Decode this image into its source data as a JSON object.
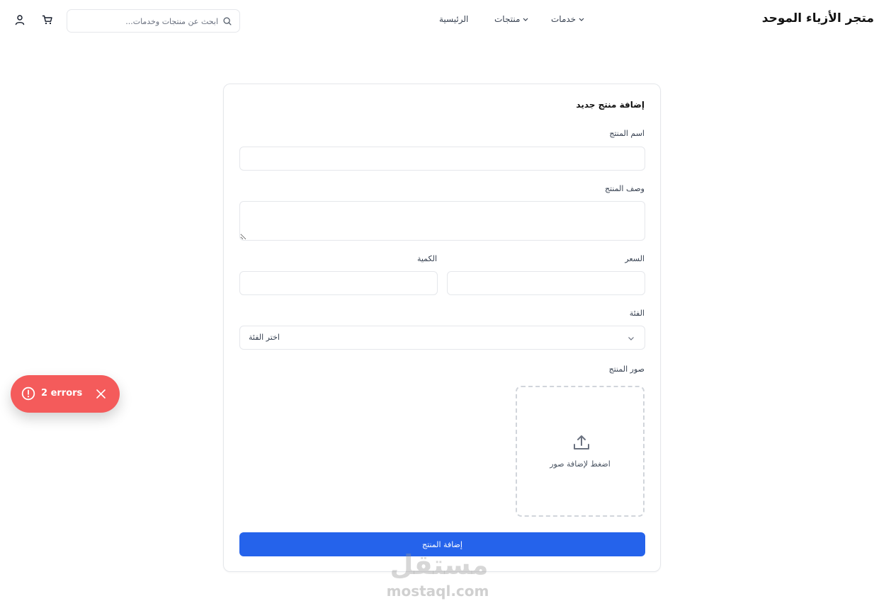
{
  "header": {
    "brand": "متجر الأزياء الموحد",
    "nav": [
      {
        "label": "الرئيسية",
        "has_dropdown": false
      },
      {
        "label": "منتجات",
        "has_dropdown": true
      },
      {
        "label": "خدمات",
        "has_dropdown": true
      }
    ],
    "search": {
      "placeholder": "ابحث عن منتجات وخدمات...",
      "value": "",
      "icon": "search-icon"
    },
    "icons": [
      "cart-icon",
      "user-icon"
    ]
  },
  "form": {
    "title": "إضافة منتج جديد",
    "name_label": "اسم المنتج",
    "name_value": "",
    "description_label": "وصف المنتج",
    "description_value": "",
    "price_label": "السعر",
    "price_value": "",
    "quantity_label": "الكمية",
    "quantity_value": "",
    "category_label": "الفئة",
    "category_value": "اختر الفئة",
    "images_label": "صور المنتج",
    "upload_text": "اضغط لإضافة صور",
    "submit_label": "إضافة المنتج"
  },
  "toast": {
    "text": "2 errors",
    "color": "#f45b5b"
  },
  "watermark": {
    "arabic": "مستقل",
    "latin": "mostaql.com"
  },
  "colors": {
    "primary": "#2563eb",
    "error": "#f45b5b"
  }
}
